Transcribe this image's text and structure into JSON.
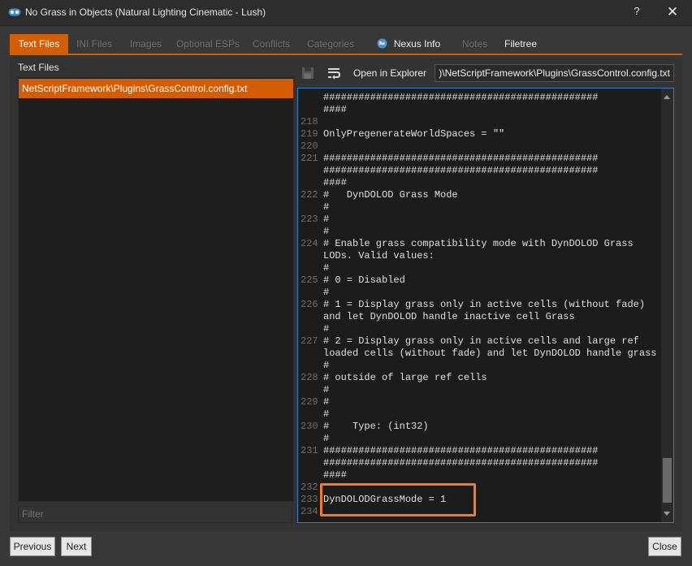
{
  "window": {
    "title": "No Grass in Objects (Natural Lighting Cinematic - Lush)",
    "help": "?",
    "close": "✕",
    "icon": "mo2-link-icon"
  },
  "tabs": [
    {
      "label": "Text Files",
      "state": "active"
    },
    {
      "label": "INI Files",
      "state": "disabled"
    },
    {
      "label": "Images",
      "state": "disabled"
    },
    {
      "label": "Optional ESPs",
      "state": "disabled"
    },
    {
      "label": "Conflicts",
      "state": "disabled"
    },
    {
      "label": "Categories",
      "state": "disabled"
    },
    {
      "label": "Nexus Info",
      "state": "enabled",
      "icon": "globe-icon"
    },
    {
      "label": "Notes",
      "state": "disabled"
    },
    {
      "label": "Filetree",
      "state": "enabled"
    }
  ],
  "left": {
    "header": "Text Files",
    "files": [
      "NetScriptFramework\\Plugins\\GrassControl.config.txt"
    ],
    "filter_placeholder": "Filter"
  },
  "toolbar": {
    "save_icon": "save-icon",
    "wrap_icon": "word-wrap-icon",
    "open_explorer": "Open in Explorer",
    "path": "Natural Lighting Cinematic - Lush)\\NetScriptFramework\\Plugins\\GrassControl.config.txt"
  },
  "editor": {
    "lines": [
      {
        "n": "",
        "t": "###############################################"
      },
      {
        "n": "",
        "t": "####"
      },
      {
        "n": "218",
        "t": ""
      },
      {
        "n": "219",
        "t": "OnlyPregenerateWorldSpaces = \"\""
      },
      {
        "n": "220",
        "t": ""
      },
      {
        "n": "221",
        "t": "###############################################"
      },
      {
        "n": "",
        "t": "###############################################"
      },
      {
        "n": "",
        "t": "####"
      },
      {
        "n": "222",
        "t": "#   DynDOLOD Grass Mode"
      },
      {
        "n": "",
        "t": "#"
      },
      {
        "n": "223",
        "t": "#"
      },
      {
        "n": "",
        "t": "#"
      },
      {
        "n": "224",
        "t": "# Enable grass compatibility mode with DynDOLOD Grass"
      },
      {
        "n": "",
        "t": "LODs. Valid values:"
      },
      {
        "n": "",
        "t": "#"
      },
      {
        "n": "225",
        "t": "# 0 = Disabled"
      },
      {
        "n": "",
        "t": "#"
      },
      {
        "n": "226",
        "t": "# 1 = Display grass only in active cells (without fade)"
      },
      {
        "n": "",
        "t": "and let DynDOLOD handle inactive cell Grass"
      },
      {
        "n": "",
        "t": "#"
      },
      {
        "n": "227",
        "t": "# 2 = Display grass only in active cells and large ref"
      },
      {
        "n": "",
        "t": "loaded cells (without fade) and let DynDOLOD handle grass"
      },
      {
        "n": "",
        "t": "#"
      },
      {
        "n": "228",
        "t": "# outside of large ref cells"
      },
      {
        "n": "",
        "t": "#"
      },
      {
        "n": "229",
        "t": "#"
      },
      {
        "n": "",
        "t": "#"
      },
      {
        "n": "230",
        "t": "#    Type: (int32)"
      },
      {
        "n": "",
        "t": "#"
      },
      {
        "n": "231",
        "t": "###############################################"
      },
      {
        "n": "",
        "t": "###############################################"
      },
      {
        "n": "",
        "t": "####"
      },
      {
        "n": "232",
        "t": ""
      },
      {
        "n": "233",
        "t": "DynDOLODGrassMode = 1"
      },
      {
        "n": "234",
        "t": ""
      }
    ],
    "highlighted_line": "233",
    "highlight_color": "#f47b20"
  },
  "buttons": {
    "previous": "Previous",
    "next": "Next",
    "close": "Close"
  },
  "colors": {
    "accent": "#d35d00",
    "editor_border": "#2f7fcf",
    "highlight": "#f47b20"
  }
}
